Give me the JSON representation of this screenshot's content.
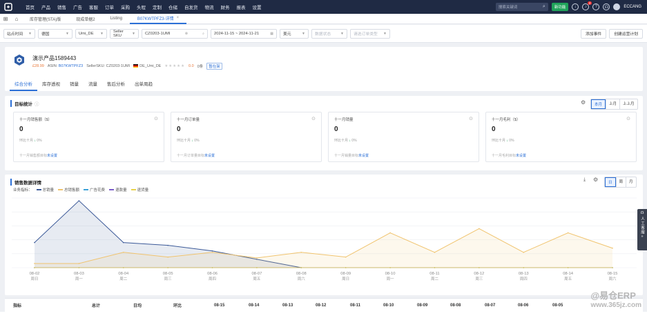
{
  "nav": {
    "items": [
      "首页",
      "产品",
      "销售",
      "广告",
      "客服",
      "订单",
      "采购",
      "头程",
      "定制",
      "仓储",
      "自发货",
      "物流",
      "财务",
      "报表",
      "设置"
    ],
    "search_placeholder": "搜索关键词",
    "new_button": "新功能",
    "notification_count": "2",
    "user": "ECCANG"
  },
  "tabs": [
    {
      "label": "库存管理(STA)版"
    },
    {
      "label": "现成单据2"
    },
    {
      "label": "Listing"
    },
    {
      "label": "B07KWTPFZ3-详情",
      "active": true
    }
  ],
  "filters": {
    "time_type": "站点时间",
    "country": "德国",
    "shop": "Umi_DE",
    "sku_type": "Seller SKU",
    "sku_value": "CZ0203-1UMI",
    "date_range": "2024-11-15 ~ 2024-11-21",
    "currency": "美元",
    "category_placeholder": "数据状态",
    "order_type_placeholder": "请选订单类型",
    "add_event": "添加事件",
    "create_report": "创建运营计划"
  },
  "product": {
    "name": "演示产品1589443",
    "price": "£28.99",
    "asin_label": "ASIN:",
    "asin": "B07KWTPFZ3",
    "seller_sku_label": "SellerSKU:",
    "seller_sku": "CZ0203-1UMI",
    "shop": "DE_Umi_DE",
    "rating": "0.0",
    "reviews": "0条",
    "tag": "暂在架",
    "subtabs": [
      "综合分析",
      "库存透视",
      "销量",
      "流量",
      "售后分析",
      "出单周趋"
    ]
  },
  "goals": {
    "title": "目标统计",
    "periods": [
      "本月",
      "上月",
      "上上月"
    ],
    "cards": [
      {
        "label": "十一月销售额（$）",
        "value": "0",
        "compare": "环比十月",
        "change": "0%",
        "target": "十一月销售额目标",
        "set": "未设置"
      },
      {
        "label": "十一月订单量",
        "value": "0",
        "compare": "环比十月",
        "change": "0%",
        "target": "十一月订单量目标",
        "set": "未设置"
      },
      {
        "label": "十一月销量",
        "value": "0",
        "compare": "环比十月",
        "change": "0%",
        "target": "十一月销量目标",
        "set": "未设置"
      },
      {
        "label": "十一月毛利（$）",
        "value": "0",
        "compare": "环比十月",
        "change": "0%",
        "target": "十一月毛利目标",
        "set": "未设置"
      }
    ]
  },
  "sales": {
    "title": "销售数据详情",
    "legend_prefix": "业务指标：",
    "views": [
      "日",
      "周",
      "月"
    ],
    "table_headers": [
      "指标",
      "总计",
      "日均",
      "环比",
      "08-15",
      "08-14",
      "08-13",
      "08-12",
      "08-11",
      "08-10",
      "08-09",
      "08-08",
      "08-07",
      "08-06",
      "08-05"
    ]
  },
  "chart_data": {
    "type": "line",
    "categories": [
      "08-02",
      "08-03",
      "08-04",
      "08-05",
      "08-06",
      "08-07",
      "08-08",
      "08-09",
      "08-10",
      "08-11",
      "08-12",
      "08-13",
      "08-14",
      "08-15"
    ],
    "weekdays": [
      "周日",
      "周一",
      "周二",
      "周三",
      "周四",
      "周五",
      "周六",
      "周日",
      "周一",
      "周二",
      "周三",
      "周四",
      "周五",
      "周六"
    ],
    "series": [
      {
        "name": "总销量",
        "color": "#3b5998",
        "area": true,
        "values": [
          9,
          24,
          9,
          8,
          6,
          3,
          0,
          null,
          null,
          null,
          null,
          null,
          null,
          null
        ]
      },
      {
        "name": "总销售额",
        "color": "#f0c36d",
        "area": true,
        "values": [
          1.5,
          1.5,
          5.5,
          3.8,
          5.5,
          3.5,
          5.5,
          3.8,
          12.5,
          5.5,
          14,
          5.5,
          12.5,
          7
        ]
      },
      {
        "name": "广告花费",
        "color": "#3aa0d8",
        "values": [
          0,
          0,
          0,
          0,
          0,
          0,
          0,
          0,
          0,
          0,
          0,
          0,
          0,
          0
        ]
      },
      {
        "name": "退款量",
        "color": "#7a5cc9",
        "values": [
          0,
          0,
          0,
          0,
          0,
          0,
          0,
          0,
          0,
          0,
          0,
          0,
          0,
          0
        ]
      },
      {
        "name": "退货量",
        "color": "#e8d24a",
        "values": [
          0,
          0,
          0,
          0,
          0,
          0,
          0,
          0,
          0,
          0,
          0,
          0,
          0,
          0
        ]
      }
    ],
    "ylim": [
      0,
      25
    ],
    "grid": true,
    "legend": "top-left"
  },
  "side": {
    "label": "人工客服"
  },
  "watermark": {
    "brand": "@易仓ERP",
    "site": "www.365jz.com"
  }
}
